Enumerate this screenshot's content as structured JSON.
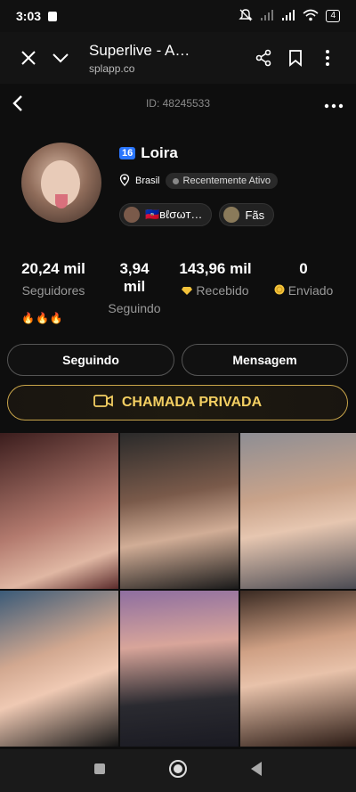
{
  "status": {
    "time": "3:03",
    "battery": "4"
  },
  "browser": {
    "title": "Superlive - Assi…",
    "url": "splapp.co"
  },
  "profile": {
    "id_label": "ID: 48245533",
    "level": "16",
    "name": "Loira",
    "country": "Brasil",
    "activity": "Recentemente Ativo",
    "tags": [
      {
        "label": "🇭🇹ʙℓσωт…"
      },
      {
        "label": "Fãs"
      }
    ],
    "emojis": "🔥🔥🔥"
  },
  "stats": [
    {
      "value": "20,24 mil",
      "label": "Seguidores"
    },
    {
      "value": "3,94 mil",
      "label": "Seguindo"
    },
    {
      "value": "143,96 mil",
      "label": "Recebido"
    },
    {
      "value": "0",
      "label": "Enviado"
    }
  ],
  "actions": {
    "following": "Seguindo",
    "message": "Mensagem",
    "private_call": "CHAMADA PRIVADA"
  },
  "colors": {
    "accent_gold": "#f3cf62",
    "level_badge": "#2a76ff"
  },
  "photos": [
    {
      "tone": "#6b3a3a"
    },
    {
      "tone": "#3a3a3a"
    },
    {
      "tone": "#6a6a70"
    },
    {
      "tone": "#444448"
    },
    {
      "tone": "#5a4a66"
    },
    {
      "tone": "#6e5a4e"
    }
  ]
}
